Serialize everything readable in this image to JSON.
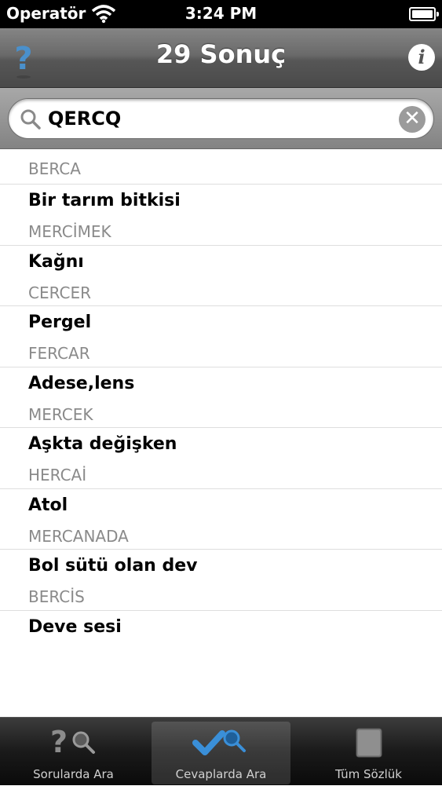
{
  "status_bar": {
    "carrier": "Operatör",
    "time": "3:24 PM"
  },
  "nav": {
    "title": "29 Sonuç",
    "info_label": "i"
  },
  "search": {
    "value": "QERCQ",
    "clear_label": "✕"
  },
  "results": {
    "first_answer": "BERCA",
    "items": [
      {
        "question": "Bir tarım bitkisi",
        "answer": "MERCİMEK"
      },
      {
        "question": "Kağnı",
        "answer": "CERCER"
      },
      {
        "question": "Pergel",
        "answer": "FERCAR"
      },
      {
        "question": "Adese,lens",
        "answer": "MERCEK"
      },
      {
        "question": "Aşkta değişken",
        "answer": "HERCAİ"
      },
      {
        "question": "Atol",
        "answer": "MERCANADA"
      },
      {
        "question": "Bol sütü olan dev",
        "answer": "BERCİS"
      },
      {
        "question": "Deve sesi",
        "answer": ""
      }
    ]
  },
  "tabs": [
    {
      "label": "Sorularda Ara",
      "icon": "question-search-icon",
      "selected": false
    },
    {
      "label": "Cevaplarda Ara",
      "icon": "check-search-icon",
      "selected": true
    },
    {
      "label": "Tüm Sözlük",
      "icon": "book-icon",
      "selected": false
    }
  ],
  "colors": {
    "accent_blue": "#3a8fd8",
    "answer_gray": "#8a8a8a"
  }
}
